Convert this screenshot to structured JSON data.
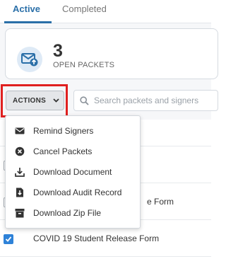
{
  "tabs": [
    {
      "label": "Active"
    },
    {
      "label": "Completed"
    }
  ],
  "summary": {
    "count": "3",
    "label": "OPEN PACKETS",
    "icon": "envelope-upload-icon"
  },
  "toolbar": {
    "actions_label": "ACTIONS",
    "search_placeholder": "Search packets and signers"
  },
  "actions_menu": [
    {
      "label": "Remind Signers",
      "icon": "envelope-icon"
    },
    {
      "label": "Cancel Packets",
      "icon": "cancel-circle-icon"
    },
    {
      "label": "Download Document",
      "icon": "download-icon"
    },
    {
      "label": "Download Audit Record",
      "icon": "download-file-icon"
    },
    {
      "label": "Download Zip File",
      "icon": "archive-box-icon"
    }
  ],
  "list": {
    "rows": [
      {
        "title": "e Form",
        "checked": false
      },
      {
        "title": "COVID 19 Student Release Form",
        "checked": true
      }
    ]
  },
  "colors": {
    "accent": "#2a6fa8",
    "highlight": "#e0201f",
    "checkbox": "#2e82d8"
  }
}
